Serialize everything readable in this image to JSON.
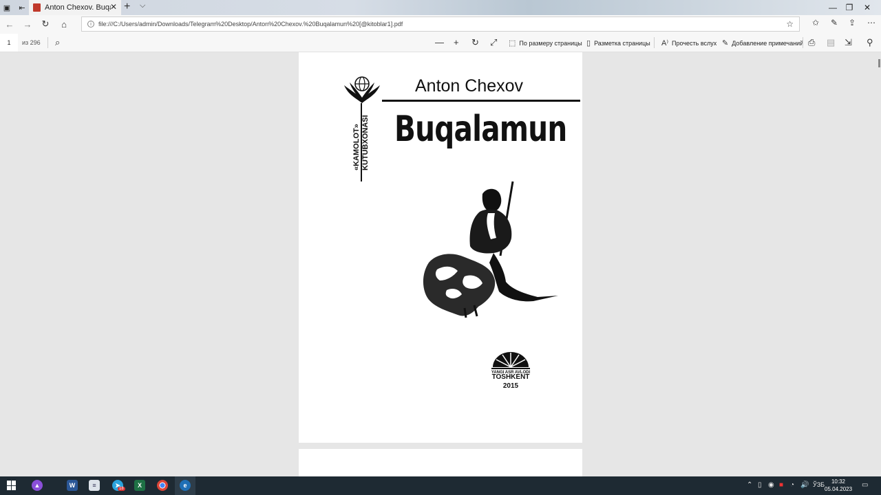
{
  "tab": {
    "title": "Anton Chexov. Buqalam",
    "close": "✕",
    "new": "+",
    "list": "⌵"
  },
  "window": {
    "minimize": "—",
    "restore": "❐",
    "close": "✕"
  },
  "address": {
    "url": "file:///C:/Users/admin/Downloads/Telegram%20Desktop/Anton%20Chexov.%20Buqalamun%20[@kitoblar1].pdf"
  },
  "pdf_toolbar": {
    "page": "1",
    "total": "из 296",
    "fit_page": "По размеру страницы",
    "page_layout": "Разметка страницы",
    "read_aloud": "Прочесть вслух",
    "add_notes": "Добавление примечаний"
  },
  "document": {
    "author": "Anton Chexov",
    "title": "Buqalamun",
    "series_line1": "«KAMOLOT»",
    "series_line2": "KUTUBXONASI",
    "publisher": "YANGI ASR AVLODI",
    "city": "TOSHKENT",
    "year": "2015"
  },
  "taskbar": {
    "lang": "ЎЗБ",
    "time": "10:32",
    "date": "05.04.2023",
    "telegram_badge": "18"
  }
}
